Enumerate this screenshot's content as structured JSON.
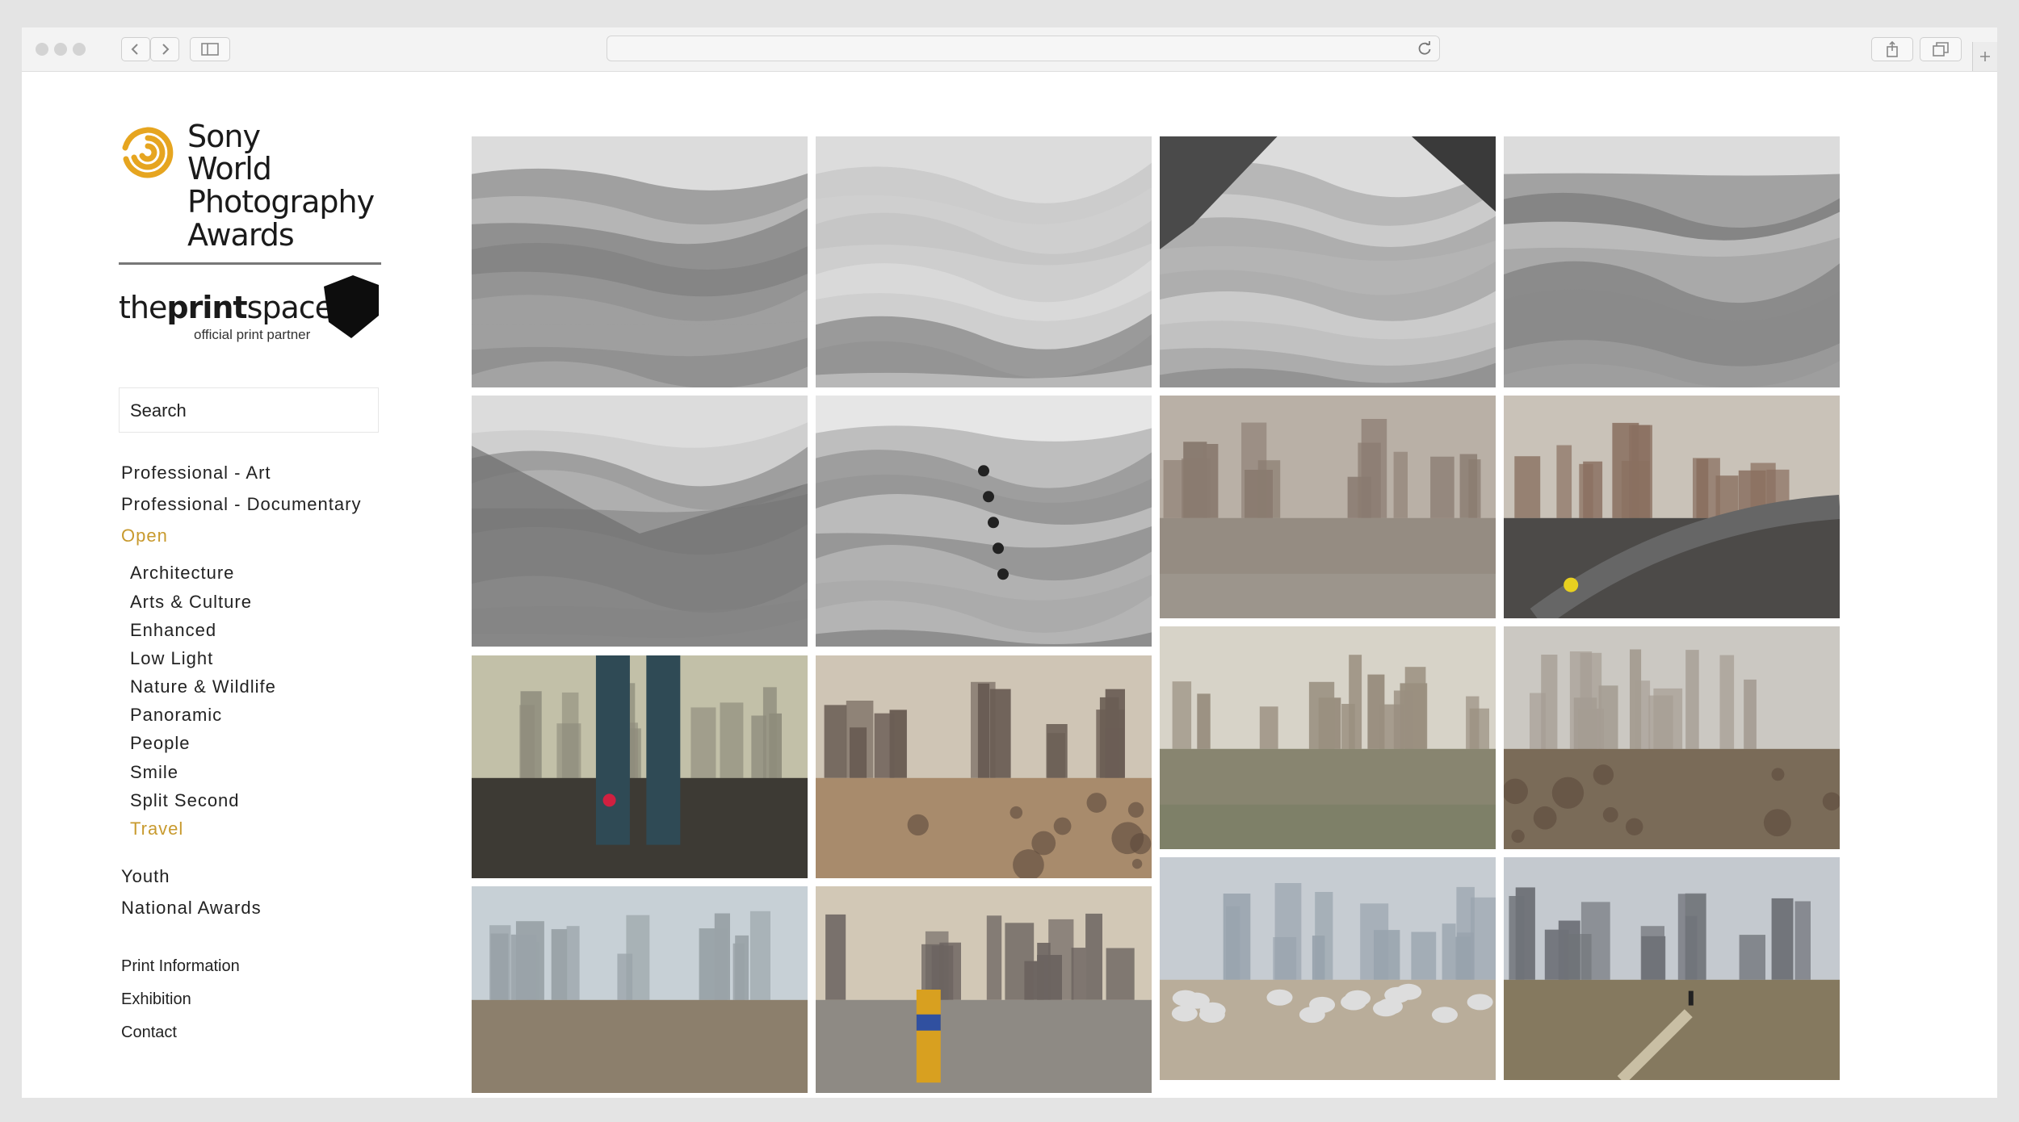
{
  "brand": {
    "sony_lines": [
      "Sony",
      "World",
      "Photography",
      "Awards"
    ],
    "partner_name_light": "the",
    "partner_name_bold": "print",
    "partner_name_tail": "space",
    "partner_tagline": "official print partner",
    "accent_color": "#c89a2e"
  },
  "search": {
    "placeholder": "Search"
  },
  "nav": {
    "categories": [
      {
        "label": "Professional - Art"
      },
      {
        "label": "Professional - Documentary"
      },
      {
        "label": "Open"
      }
    ],
    "open_subcategories": [
      {
        "label": "Architecture"
      },
      {
        "label": "Arts & Culture"
      },
      {
        "label": "Enhanced"
      },
      {
        "label": "Low Light"
      },
      {
        "label": "Nature & Wildlife"
      },
      {
        "label": "Panoramic"
      },
      {
        "label": "People"
      },
      {
        "label": "Smile"
      },
      {
        "label": "Split Second"
      },
      {
        "label": "Travel"
      }
    ],
    "more_categories": [
      {
        "label": "Youth"
      },
      {
        "label": "National Awards"
      }
    ],
    "footer_links": [
      {
        "label": "Print Information"
      },
      {
        "label": "Exhibition"
      },
      {
        "label": "Contact"
      }
    ]
  },
  "gallery": {
    "photos": [
      {
        "kind": "glacier-cover"
      },
      {
        "kind": "glacier-cover"
      },
      {
        "kind": "glacier-valley"
      },
      {
        "kind": "glacier-cover"
      },
      {
        "kind": "glacier-slope"
      },
      {
        "kind": "snow-texture"
      },
      {
        "kind": "river-towers"
      },
      {
        "kind": "highway-towers"
      },
      {
        "kind": "pillars-fog"
      },
      {
        "kind": "dunes-towers"
      },
      {
        "kind": "pond-towers"
      },
      {
        "kind": "dirt-road-towers"
      },
      {
        "kind": "construction-towers"
      },
      {
        "kind": "riverbank-person"
      },
      {
        "kind": "sheep-towers"
      },
      {
        "kind": "field-path-towers"
      }
    ]
  }
}
